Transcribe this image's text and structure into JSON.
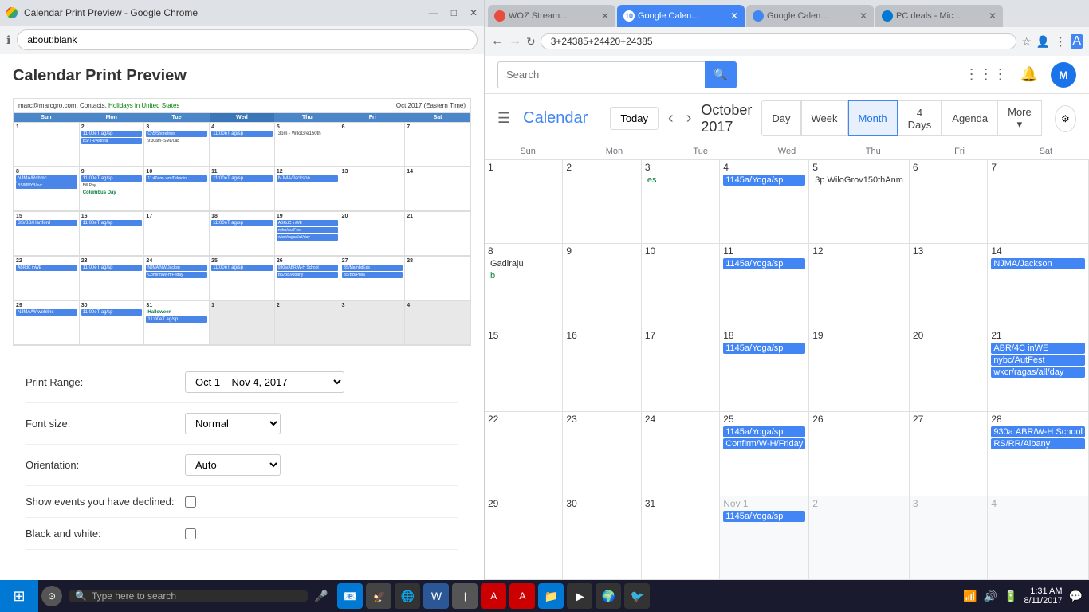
{
  "left_browser": {
    "title": "Calendar Print Preview - Google Chrome",
    "address": "about:blank",
    "print_preview_title": "Calendar Print Preview",
    "cal_header_left": "marc@marcgro.com, Contacts, Holidays in United States",
    "cal_header_right": "Oct 2017 (Eastern Time)",
    "day_names": [
      "Sun",
      "Mon",
      "Tue",
      "Wed",
      "Thu",
      "Fri",
      "Sat"
    ],
    "print_range_label": "Print Range:",
    "print_range_value": "Oct 1 – Nov 4, 2017",
    "font_size_label": "Font size:",
    "font_size_value": "Normal",
    "orientation_label": "Orientation:",
    "orientation_value": "Auto",
    "declined_label": "Show events you have declined:",
    "bw_label": "Black and white:"
  },
  "right_browser": {
    "tabs": [
      {
        "label": "WOZ Stream...",
        "active": false,
        "color": "#e74c3c"
      },
      {
        "label": "Google Calen...",
        "active": true,
        "color": "#4285f4"
      },
      {
        "label": "Google Calen...",
        "active": false,
        "color": "#4285f4"
      },
      {
        "label": "PC deals - Mic...",
        "active": false,
        "color": "#0078d4"
      }
    ],
    "address": "3+24385+24420+24385",
    "month_title": "October 2017",
    "view_buttons": [
      "Day",
      "Week",
      "Month",
      "4 Days",
      "Agenda",
      "More ▾"
    ],
    "active_view": "Month",
    "col_headers": [
      "Sun",
      "Mon",
      "Tue",
      "Wed",
      "Thu",
      "Fri",
      "Sat"
    ],
    "weeks": [
      {
        "days": [
          {
            "date": "1",
            "other": false,
            "events": []
          },
          {
            "date": "2",
            "other": false,
            "events": []
          },
          {
            "date": "3",
            "other": false,
            "events": []
          },
          {
            "date": "4",
            "other": false,
            "events": [
              {
                "text": "1145a/Yoga/sp",
                "type": "blue"
              }
            ]
          },
          {
            "date": "5",
            "other": false,
            "events": [
              {
                "text": "3p WiloGrov150thAnm",
                "type": "text"
              }
            ]
          },
          {
            "date": "6",
            "other": false,
            "events": []
          },
          {
            "date": "7",
            "other": false,
            "events": []
          }
        ]
      },
      {
        "days": [
          {
            "date": "8",
            "other": false,
            "events": [
              {
                "text": "Gadiraju",
                "type": "text"
              }
            ]
          },
          {
            "date": "9",
            "other": false,
            "events": []
          },
          {
            "date": "10",
            "other": false,
            "events": []
          },
          {
            "date": "11",
            "other": false,
            "events": [
              {
                "text": "1145a/Yoga/sp",
                "type": "blue"
              }
            ]
          },
          {
            "date": "12",
            "other": false,
            "events": []
          },
          {
            "date": "13",
            "other": false,
            "events": []
          },
          {
            "date": "14",
            "other": false,
            "events": [
              {
                "text": "NJMA/Jackson",
                "type": "blue"
              }
            ]
          }
        ]
      },
      {
        "days": [
          {
            "date": "15",
            "other": false,
            "events": []
          },
          {
            "date": "16",
            "other": false,
            "events": []
          },
          {
            "date": "17",
            "other": false,
            "events": []
          },
          {
            "date": "18",
            "other": false,
            "events": [
              {
                "text": "1145a/Yoga/sp",
                "type": "blue"
              }
            ]
          },
          {
            "date": "19",
            "other": false,
            "events": []
          },
          {
            "date": "20",
            "other": false,
            "events": []
          },
          {
            "date": "21",
            "other": false,
            "events": [
              {
                "text": "ABR/4C inWE",
                "type": "blue"
              },
              {
                "text": "nybc/AutFest",
                "type": "blue"
              },
              {
                "text": "wkcr/ragas/all/day",
                "type": "blue"
              }
            ]
          }
        ]
      },
      {
        "days": [
          {
            "date": "22",
            "other": false,
            "events": []
          },
          {
            "date": "23",
            "other": false,
            "events": []
          },
          {
            "date": "24",
            "other": false,
            "events": []
          },
          {
            "date": "25",
            "other": false,
            "events": [
              {
                "text": "1145a/Yoga/sp",
                "type": "blue"
              },
              {
                "text": "Confirm/W-H/Friday",
                "type": "blue"
              }
            ]
          },
          {
            "date": "26",
            "other": false,
            "events": []
          },
          {
            "date": "27",
            "other": false,
            "events": []
          },
          {
            "date": "28",
            "other": false,
            "events": [
              {
                "text": "930a:ABR/W-H School",
                "type": "blue"
              },
              {
                "text": "RS/RR/Albany",
                "type": "blue"
              }
            ]
          }
        ]
      },
      {
        "days": [
          {
            "date": "29",
            "other": false,
            "events": []
          },
          {
            "date": "30",
            "other": false,
            "events": []
          },
          {
            "date": "31",
            "other": false,
            "events": []
          },
          {
            "date": "1",
            "other": true,
            "events": [
              {
                "text": "1145a/Yoga/sp",
                "type": "blue"
              }
            ]
          },
          {
            "date": "2",
            "other": true,
            "events": []
          },
          {
            "date": "3",
            "other": true,
            "events": []
          },
          {
            "date": "4",
            "other": true,
            "events": []
          }
        ]
      }
    ]
  },
  "taskbar": {
    "search_placeholder": "Type here to search",
    "time": "1:31 AM",
    "date": "8/11/2017"
  }
}
